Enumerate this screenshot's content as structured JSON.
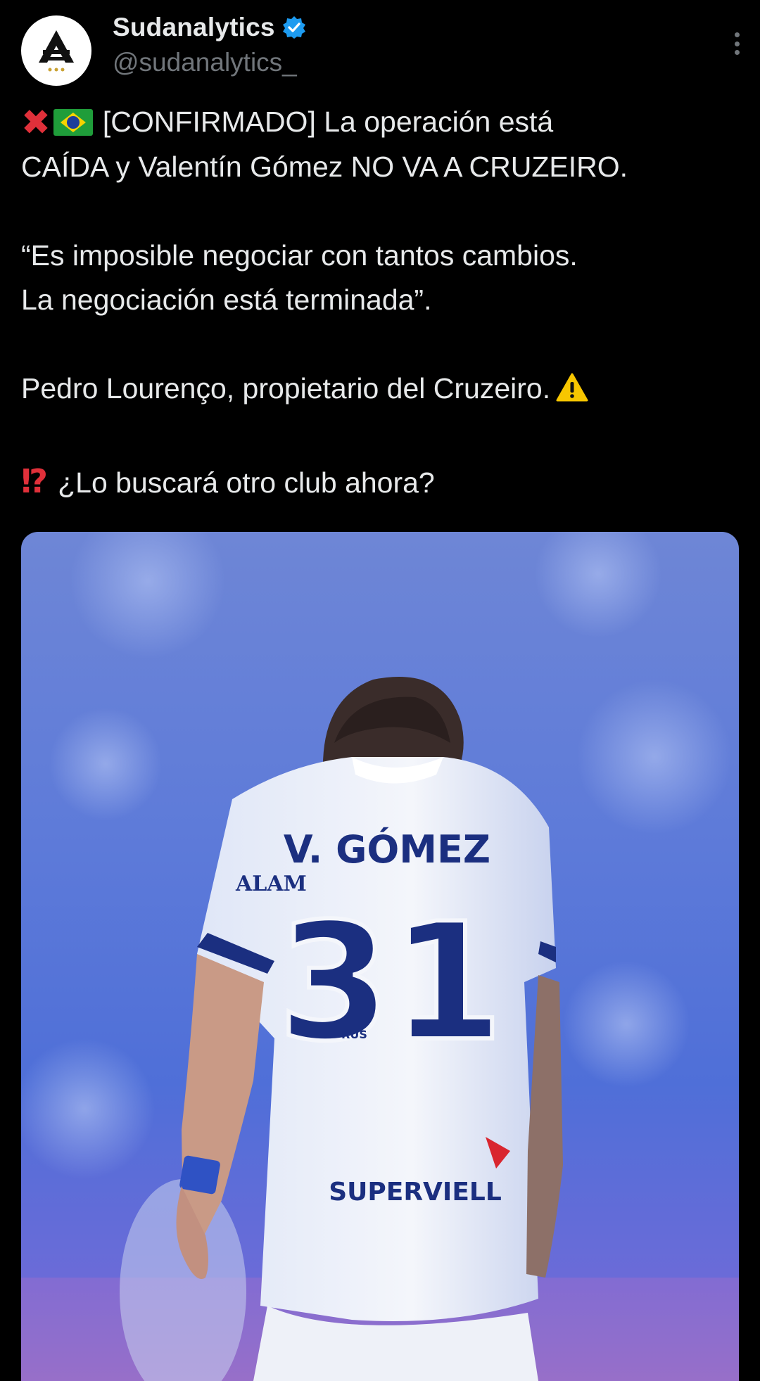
{
  "header": {
    "display_name": "Sudanalytics",
    "handle": "@sudanalytics_",
    "verified": true,
    "avatar_icon": "sudanalytics-logo-icon"
  },
  "tweet": {
    "line1_text": "[CONFIRMADO] La operación está",
    "line2_text": "CAÍDA y Valentín Gómez NO VA A CRUZEIRO.",
    "quote_line1": "“Es imposible negociar con tantos cambios.",
    "quote_line2": "La negociación está terminada”.",
    "attribution": "Pedro Lourenço, propietario del Cruzeiro.",
    "question": "¿Lo buscará otro club ahora?",
    "icons": [
      "cross-mark-icon",
      "brazil-flag-icon",
      "warning-icon",
      "interrobang-icon"
    ]
  },
  "media": {
    "jersey_name": "V. GÓMEZ",
    "jersey_number": "31",
    "sponsor": "SUPERVIELL",
    "sleeve_sponsor": "ALAM",
    "brand": "RUS"
  },
  "colors": {
    "background": "#000000",
    "text": "#e7e9ea",
    "secondary": "#71767b",
    "verified": "#1d9bf0",
    "jersey_blue": "#1b2f80"
  }
}
